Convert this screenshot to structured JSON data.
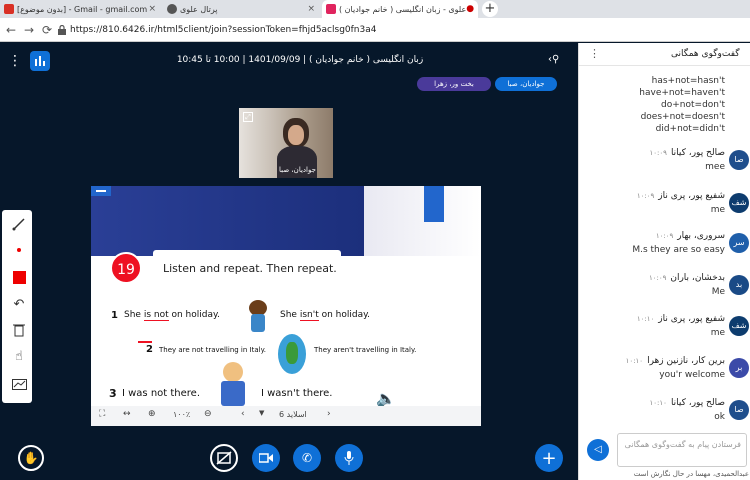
{
  "browser": {
    "tabs": [
      {
        "label": "[بدون موضوع] - Gmail - gmail.com"
      },
      {
        "label": "پرتال علوی"
      },
      {
        "label": "علوی - زبان انگلیسی ( خانم جوادیان )"
      }
    ],
    "url": "https://810.6426.ir/html5client/join?sessionToken=fhjd5aclsg0fn3a4"
  },
  "session": {
    "title": "زبان انگلیسی ( خانم جوادیان ) | 1401/09/09 | 10:00 تا 10:45",
    "presenters": [
      "جوادیان، صبا",
      "بخت ور، زهرا"
    ]
  },
  "webcam": {
    "label": "جوادیان، صبا"
  },
  "slide": {
    "number": "19",
    "heading": "Listen and repeat. Then repeat.",
    "line1_a": "She ",
    "line1_b": "is not",
    "line1_c": " on holiday.",
    "line1_d": "She ",
    "line1_e": "isn't",
    "line1_f": " on holiday.",
    "line2_a": "They are not travelling in Italy.",
    "line2_b": "They aren't travelling in Italy.",
    "line3_a": "I was not there.",
    "line3_b": "I wasn't there.",
    "n1": "1",
    "n2": "2",
    "n3": "3"
  },
  "slidebar": {
    "zoom": "۱۰۰٪",
    "slide_label": "اسلاید 6"
  },
  "chat": {
    "header": "گفت‌وگوی همگانی",
    "grammar": [
      "has+not=hasn't",
      "have+not=haven't",
      "do+not=don't",
      "does+not=doesn't",
      "did+not=didn't"
    ],
    "messages": [
      {
        "initials": "صا",
        "name": "صالح پور، کیانا",
        "time": "۱۰:۰۹",
        "text": "mee",
        "color": "#1f4e8c"
      },
      {
        "initials": "شف",
        "name": "شفیع پور، پری ناز",
        "time": "۱۰:۰۹",
        "text": "me",
        "color": "#0d3c6e"
      },
      {
        "initials": "سر",
        "name": "سروری، بهار",
        "time": "۱۰:۰۹",
        "text": "M.s they are so easy",
        "color": "#1f5faa"
      },
      {
        "initials": "بد",
        "name": "بدخشان، باران",
        "time": "۱۰:۰۹",
        "text": "Me",
        "color": "#1a4a86"
      },
      {
        "initials": "شف",
        "name": "شفیع پور، پری ناز",
        "time": "۱۰:۱۰",
        "text": "me",
        "color": "#0d3c6e"
      },
      {
        "initials": "بر",
        "name": "برین کار، نازنین زهرا",
        "time": "۱۰:۱۰",
        "text": "you'r welcome",
        "color": "#3b4aa8"
      },
      {
        "initials": "صا",
        "name": "صالح پور، کیانا",
        "time": "۱۰:۱۰",
        "text": "ok",
        "color": "#1f4e8c"
      }
    ],
    "input_placeholder": "فرستادن پیام به گفت‌وگوی همگانی",
    "typing": "عبدالحمیدی، مهسا در حال نگارش است"
  },
  "colors": {
    "accent": "#0f70d7",
    "dark_bg": "#06172a",
    "slide_blue": "#233a8c"
  }
}
